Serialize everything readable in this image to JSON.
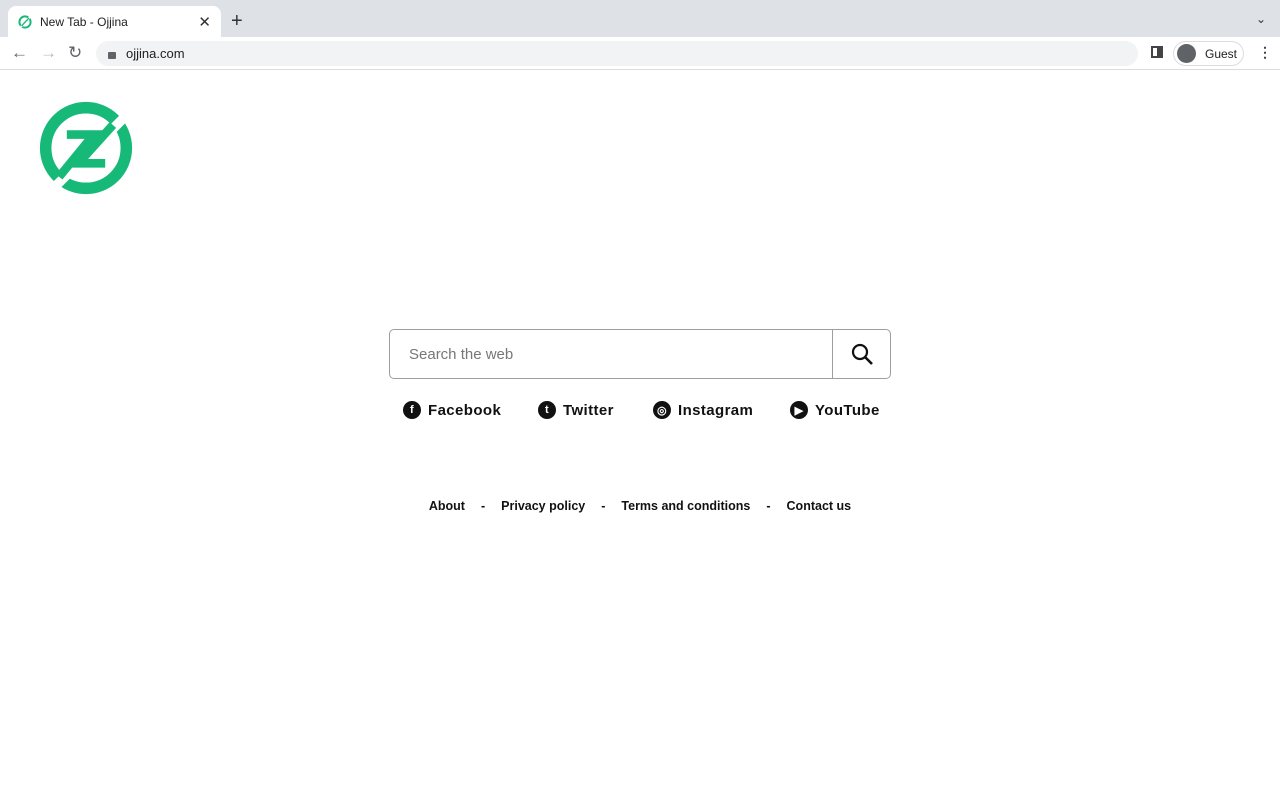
{
  "browser": {
    "tab_title": "New Tab - Ojjina",
    "url": "ojjina.com",
    "profile": "Guest"
  },
  "brand": {
    "color": "#17b978"
  },
  "search": {
    "placeholder": "Search the web"
  },
  "social": [
    {
      "label": "Facebook",
      "icon": "facebook-icon"
    },
    {
      "label": "Twitter",
      "icon": "twitter-icon"
    },
    {
      "label": "Instagram",
      "icon": "instagram-icon"
    },
    {
      "label": "YouTube",
      "icon": "youtube-icon"
    }
  ],
  "footer": {
    "links": [
      "About",
      "Privacy policy",
      "Terms and conditions",
      "Contact us"
    ],
    "separator": "-"
  }
}
